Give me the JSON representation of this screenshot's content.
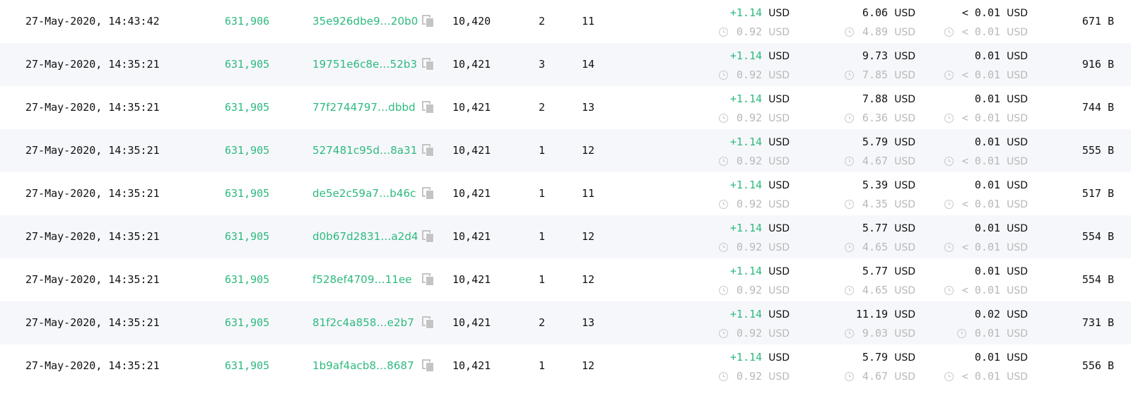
{
  "table": {
    "rows": [
      {
        "time": "27-May-2020, 14:43:42",
        "block": "631,906",
        "hash": "35e926dbe9…20b0",
        "confirmations": "10,420",
        "inputs": "2",
        "outputs": "11",
        "output_usd": "+1.14",
        "output_usd_unit": "USD",
        "output_usd_then": "0.92",
        "output_usd_then_unit": "USD",
        "fee_usd": "6.06",
        "fee_usd_unit": "USD",
        "fee_usd_then": "4.89",
        "fee_usd_then_unit": "USD",
        "fee_per_kb": "< 0.01",
        "fee_per_kb_unit": "USD",
        "fee_per_kb_then": "< 0.01",
        "fee_per_kb_then_unit": "USD",
        "size": "671 B"
      },
      {
        "time": "27-May-2020, 14:35:21",
        "block": "631,905",
        "hash": "19751e6c8e…52b3",
        "confirmations": "10,421",
        "inputs": "3",
        "outputs": "14",
        "output_usd": "+1.14",
        "output_usd_unit": "USD",
        "output_usd_then": "0.92",
        "output_usd_then_unit": "USD",
        "fee_usd": "9.73",
        "fee_usd_unit": "USD",
        "fee_usd_then": "7.85",
        "fee_usd_then_unit": "USD",
        "fee_per_kb": "0.01",
        "fee_per_kb_unit": "USD",
        "fee_per_kb_then": "< 0.01",
        "fee_per_kb_then_unit": "USD",
        "size": "916 B"
      },
      {
        "time": "27-May-2020, 14:35:21",
        "block": "631,905",
        "hash": "77f2744797…dbbd",
        "confirmations": "10,421",
        "inputs": "2",
        "outputs": "13",
        "output_usd": "+1.14",
        "output_usd_unit": "USD",
        "output_usd_then": "0.92",
        "output_usd_then_unit": "USD",
        "fee_usd": "7.88",
        "fee_usd_unit": "USD",
        "fee_usd_then": "6.36",
        "fee_usd_then_unit": "USD",
        "fee_per_kb": "0.01",
        "fee_per_kb_unit": "USD",
        "fee_per_kb_then": "< 0.01",
        "fee_per_kb_then_unit": "USD",
        "size": "744 B"
      },
      {
        "time": "27-May-2020, 14:35:21",
        "block": "631,905",
        "hash": "527481c95d…8a31",
        "confirmations": "10,421",
        "inputs": "1",
        "outputs": "12",
        "output_usd": "+1.14",
        "output_usd_unit": "USD",
        "output_usd_then": "0.92",
        "output_usd_then_unit": "USD",
        "fee_usd": "5.79",
        "fee_usd_unit": "USD",
        "fee_usd_then": "4.67",
        "fee_usd_then_unit": "USD",
        "fee_per_kb": "0.01",
        "fee_per_kb_unit": "USD",
        "fee_per_kb_then": "< 0.01",
        "fee_per_kb_then_unit": "USD",
        "size": "555 B"
      },
      {
        "time": "27-May-2020, 14:35:21",
        "block": "631,905",
        "hash": "de5e2c59a7…b46c",
        "confirmations": "10,421",
        "inputs": "1",
        "outputs": "11",
        "output_usd": "+1.14",
        "output_usd_unit": "USD",
        "output_usd_then": "0.92",
        "output_usd_then_unit": "USD",
        "fee_usd": "5.39",
        "fee_usd_unit": "USD",
        "fee_usd_then": "4.35",
        "fee_usd_then_unit": "USD",
        "fee_per_kb": "0.01",
        "fee_per_kb_unit": "USD",
        "fee_per_kb_then": "< 0.01",
        "fee_per_kb_then_unit": "USD",
        "size": "517 B"
      },
      {
        "time": "27-May-2020, 14:35:21",
        "block": "631,905",
        "hash": "d0b67d2831…a2d4",
        "confirmations": "10,421",
        "inputs": "1",
        "outputs": "12",
        "output_usd": "+1.14",
        "output_usd_unit": "USD",
        "output_usd_then": "0.92",
        "output_usd_then_unit": "USD",
        "fee_usd": "5.77",
        "fee_usd_unit": "USD",
        "fee_usd_then": "4.65",
        "fee_usd_then_unit": "USD",
        "fee_per_kb": "0.01",
        "fee_per_kb_unit": "USD",
        "fee_per_kb_then": "< 0.01",
        "fee_per_kb_then_unit": "USD",
        "size": "554 B"
      },
      {
        "time": "27-May-2020, 14:35:21",
        "block": "631,905",
        "hash": "f528ef4709…11ee",
        "confirmations": "10,421",
        "inputs": "1",
        "outputs": "12",
        "output_usd": "+1.14",
        "output_usd_unit": "USD",
        "output_usd_then": "0.92",
        "output_usd_then_unit": "USD",
        "fee_usd": "5.77",
        "fee_usd_unit": "USD",
        "fee_usd_then": "4.65",
        "fee_usd_then_unit": "USD",
        "fee_per_kb": "0.01",
        "fee_per_kb_unit": "USD",
        "fee_per_kb_then": "< 0.01",
        "fee_per_kb_then_unit": "USD",
        "size": "554 B"
      },
      {
        "time": "27-May-2020, 14:35:21",
        "block": "631,905",
        "hash": "81f2c4a858…e2b7",
        "confirmations": "10,421",
        "inputs": "2",
        "outputs": "13",
        "output_usd": "+1.14",
        "output_usd_unit": "USD",
        "output_usd_then": "0.92",
        "output_usd_then_unit": "USD",
        "fee_usd": "11.19",
        "fee_usd_unit": "USD",
        "fee_usd_then": "9.03",
        "fee_usd_then_unit": "USD",
        "fee_per_kb": "0.02",
        "fee_per_kb_unit": "USD",
        "fee_per_kb_then": "0.01",
        "fee_per_kb_then_unit": "USD",
        "size": "731 B"
      },
      {
        "time": "27-May-2020, 14:35:21",
        "block": "631,905",
        "hash": "1b9af4acb8…8687",
        "confirmations": "10,421",
        "inputs": "1",
        "outputs": "12",
        "output_usd": "+1.14",
        "output_usd_unit": "USD",
        "output_usd_then": "0.92",
        "output_usd_then_unit": "USD",
        "fee_usd": "5.79",
        "fee_usd_unit": "USD",
        "fee_usd_then": "4.67",
        "fee_usd_then_unit": "USD",
        "fee_per_kb": "0.01",
        "fee_per_kb_unit": "USD",
        "fee_per_kb_then": "< 0.01",
        "fee_per_kb_then_unit": "USD",
        "size": "556 B"
      }
    ]
  },
  "icons": {
    "copy": "copy-icon",
    "clock": "clock-icon"
  },
  "colors": {
    "accent_green": "#2dba7e",
    "muted_gray": "#b8b8b8",
    "row_alt_bg": "#f6f7fb",
    "text": "#111111"
  }
}
